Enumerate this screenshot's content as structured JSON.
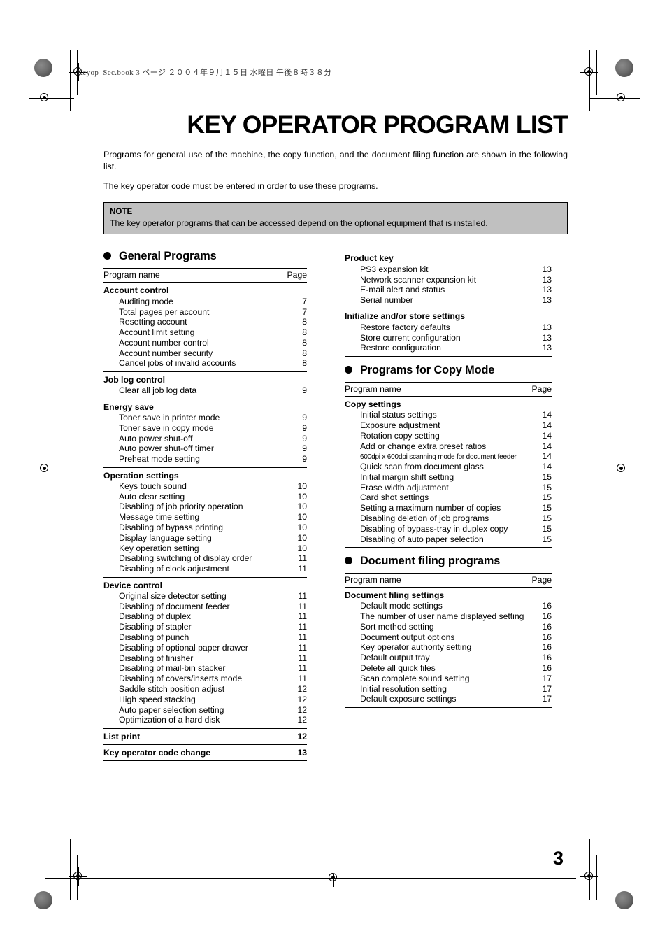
{
  "running_head": "Keyop_Sec.book   3 ページ   ２００４年９月１５日   水曜日   午後８時３８分",
  "title": "KEY OPERATOR PROGRAM LIST",
  "intro": {
    "paragraph_1": "Programs for general use of the machine, the copy function, and the document filing function are shown in the following list.",
    "paragraph_2": "The key operator code must be entered in order to use these programs."
  },
  "note": {
    "label": "NOTE",
    "text": "The key operator programs that can be accessed depend on the optional equipment that is installed."
  },
  "columns": {
    "left": {
      "section": {
        "bullet": "filled-circle-bullet",
        "title": "General Programs"
      },
      "header": {
        "name": "Program name",
        "page": "Page"
      },
      "groups": [
        {
          "title": "Account control",
          "items": [
            {
              "name": "Auditing mode",
              "page": "7"
            },
            {
              "name": "Total pages per account",
              "page": "7"
            },
            {
              "name": "Resetting account",
              "page": "8"
            },
            {
              "name": "Account limit setting",
              "page": "8"
            },
            {
              "name": "Account number control",
              "page": "8"
            },
            {
              "name": "Account number security",
              "page": "8"
            },
            {
              "name": "Cancel jobs of invalid accounts",
              "page": "8"
            }
          ]
        },
        {
          "title": "Job log control",
          "items": [
            {
              "name": "Clear all job log data",
              "page": "9"
            }
          ]
        },
        {
          "title": "Energy save",
          "items": [
            {
              "name": "Toner save in printer mode",
              "page": "9"
            },
            {
              "name": "Toner save in copy mode",
              "page": "9"
            },
            {
              "name": "Auto power shut-off",
              "page": "9"
            },
            {
              "name": "Auto power shut-off timer",
              "page": "9"
            },
            {
              "name": "Preheat mode setting",
              "page": "9"
            }
          ]
        },
        {
          "title": "Operation settings",
          "items": [
            {
              "name": "Keys touch sound",
              "page": "10"
            },
            {
              "name": "Auto clear setting",
              "page": "10"
            },
            {
              "name": "Disabling of job priority operation",
              "page": "10"
            },
            {
              "name": "Message time setting",
              "page": "10"
            },
            {
              "name": "Disabling of bypass printing",
              "page": "10"
            },
            {
              "name": "Display language setting",
              "page": "10"
            },
            {
              "name": "Key operation setting",
              "page": "10"
            },
            {
              "name": "Disabling switching of display order",
              "page": "11"
            },
            {
              "name": "Disabling of clock adjustment",
              "page": "11"
            }
          ]
        },
        {
          "title": "Device control",
          "items": [
            {
              "name": "Original size detector setting",
              "page": "11"
            },
            {
              "name": "Disabling of document feeder",
              "page": "11"
            },
            {
              "name": "Disabling of duplex",
              "page": "11"
            },
            {
              "name": "Disabling of stapler",
              "page": "11"
            },
            {
              "name": "Disabling of punch",
              "page": "11"
            },
            {
              "name": "Disabling of optional paper drawer",
              "page": "11"
            },
            {
              "name": "Disabling of finisher",
              "page": "11"
            },
            {
              "name": "Disabling of mail-bin stacker",
              "page": "11"
            },
            {
              "name": "Disabling of covers/inserts mode",
              "page": "11"
            },
            {
              "name": "Saddle stitch position adjust",
              "page": "12"
            },
            {
              "name": "High speed stacking",
              "page": "12"
            },
            {
              "name": "Auto paper selection setting",
              "page": "12"
            },
            {
              "name": "Optimization of a hard disk",
              "page": "12"
            }
          ]
        }
      ],
      "solo_rows": [
        {
          "name": "List print",
          "page": "12"
        },
        {
          "name": "Key operator code change",
          "page": "13"
        }
      ]
    },
    "right": {
      "top_groups": [
        {
          "title": "Product key",
          "items": [
            {
              "name": "PS3 expansion kit",
              "page": "13"
            },
            {
              "name": "Network scanner expansion kit",
              "page": "13"
            },
            {
              "name": "E-mail alert and status",
              "page": "13"
            },
            {
              "name": "Serial number",
              "page": "13"
            }
          ]
        },
        {
          "title": "Initialize and/or store settings",
          "items": [
            {
              "name": "Restore factory defaults",
              "page": "13"
            },
            {
              "name": "Store current configuration",
              "page": "13"
            },
            {
              "name": "Restore configuration",
              "page": "13"
            }
          ]
        }
      ],
      "copy_section": {
        "bullet": "filled-circle-bullet",
        "title": "Programs for Copy Mode",
        "header": {
          "name": "Program name",
          "page": "Page"
        },
        "groups": [
          {
            "title": "Copy settings",
            "items": [
              {
                "name": "Initial status settings",
                "page": "14"
              },
              {
                "name": "Exposure adjustment",
                "page": "14"
              },
              {
                "name": "Rotation copy setting",
                "page": "14"
              },
              {
                "name": "Add or change extra preset ratios",
                "page": "14"
              },
              {
                "name": "600dpi x 600dpi scanning mode for document feeder",
                "page": "14",
                "small": true
              },
              {
                "name": "Quick scan from document glass",
                "page": "14"
              },
              {
                "name": "Initial margin shift setting",
                "page": "15"
              },
              {
                "name": "Erase width adjustment",
                "page": "15"
              },
              {
                "name": "Card shot settings",
                "page": "15"
              },
              {
                "name": "Setting a maximum number of copies",
                "page": "15"
              },
              {
                "name": "Disabling deletion of job programs",
                "page": "15"
              },
              {
                "name": "Disabling of bypass-tray in duplex copy",
                "page": "15"
              },
              {
                "name": "Disabling of auto paper selection",
                "page": "15"
              }
            ]
          }
        ]
      },
      "filing_section": {
        "bullet": "filled-circle-bullet",
        "title": "Document filing programs",
        "header": {
          "name": "Program name",
          "page": "Page"
        },
        "groups": [
          {
            "title": "Document filing settings",
            "items": [
              {
                "name": "Default mode settings",
                "page": "16"
              },
              {
                "name": "The number of user name displayed setting",
                "page": "16"
              },
              {
                "name": "Sort method setting",
                "page": "16"
              },
              {
                "name": "Document output options",
                "page": "16"
              },
              {
                "name": "Key operator authority setting",
                "page": "16"
              },
              {
                "name": "Default output tray",
                "page": "16"
              },
              {
                "name": "Delete all quick files",
                "page": "16"
              },
              {
                "name": "Scan complete sound setting",
                "page": "17"
              },
              {
                "name": "Initial resolution setting",
                "page": "17"
              },
              {
                "name": "Default exposure settings",
                "page": "17"
              }
            ]
          }
        ]
      }
    }
  },
  "page_number": "3"
}
